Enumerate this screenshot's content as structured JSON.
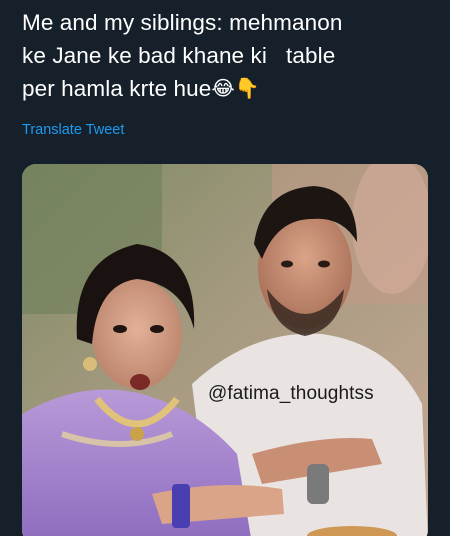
{
  "tweet": {
    "text_lines": [
      "Me and my siblings: mehmanon",
      "ke Jane ke bad khane ki   table",
      "per hamla krte hue"
    ],
    "emoji_laugh": "😂",
    "emoji_point": "👇",
    "translate_label": "Translate Tweet"
  },
  "media": {
    "watermark": "@fatima_thoughtss"
  },
  "colors": {
    "background": "#15202b",
    "text": "#ffffff",
    "link": "#1d9bf0"
  }
}
